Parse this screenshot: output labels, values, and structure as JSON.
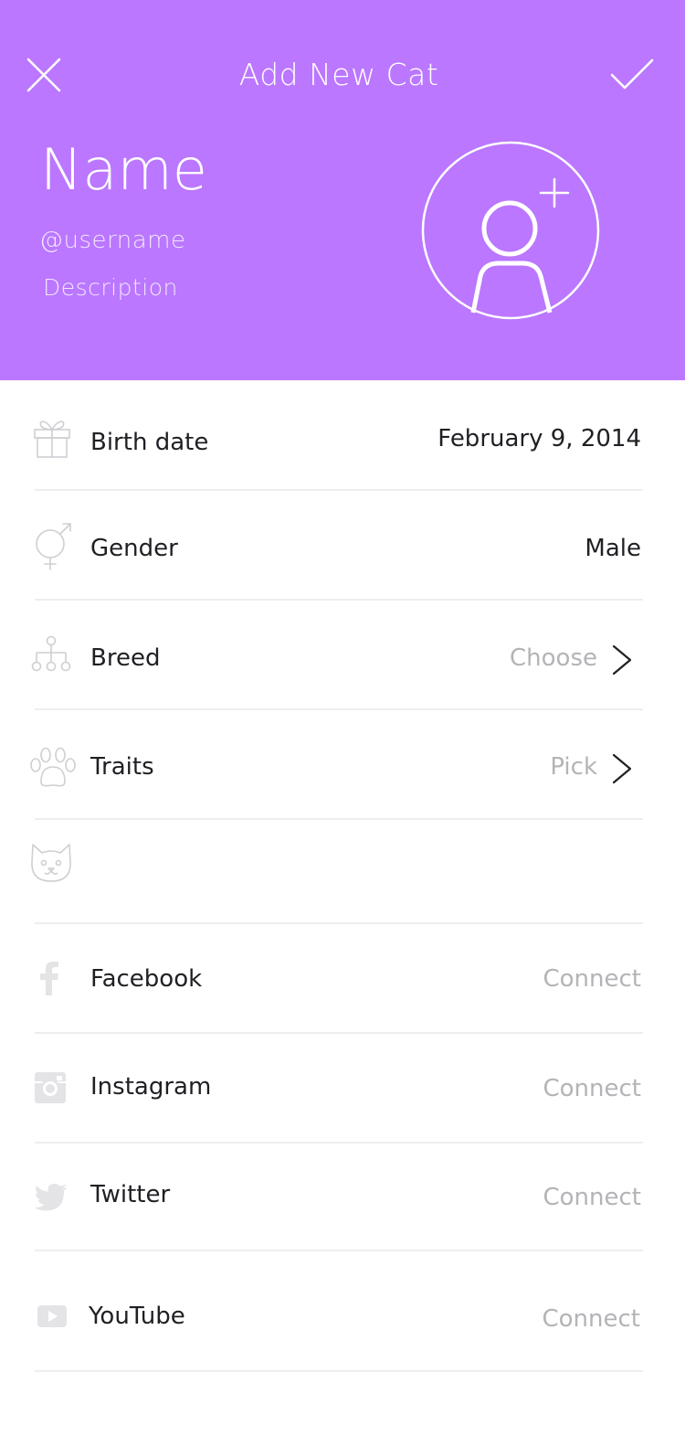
{
  "header": {
    "title": "Add New Cat",
    "name_placeholder": "Name",
    "username_placeholder": "@username",
    "description_placeholder": "Description",
    "background_color": "#bb77ff"
  },
  "rows": {
    "birth_date": {
      "label": "Birth date",
      "value": "February 9, 2014",
      "icon": "gift-icon"
    },
    "gender": {
      "label": "Gender",
      "value": "Male",
      "icon": "gender-icon"
    },
    "breed": {
      "label": "Breed",
      "value": "Choose",
      "icon": "hierarchy-icon"
    },
    "traits": {
      "label": "Traits",
      "value": "Pick",
      "icon": "paw-icon"
    },
    "cat": {
      "label": "",
      "icon": "cat-face-icon"
    },
    "facebook": {
      "label": "Facebook",
      "value": "Connect",
      "icon": "facebook-icon"
    },
    "instagram": {
      "label": "Instagram",
      "value": "Connect",
      "icon": "instagram-icon"
    },
    "twitter": {
      "label": "Twitter",
      "value": "Connect",
      "icon": "twitter-icon"
    },
    "youtube": {
      "label": "YouTube",
      "value": "Connect",
      "icon": "youtube-icon"
    }
  },
  "colors": {
    "muted_text": "#b4b4b8",
    "icon_gray": "#cfcfd3",
    "divider": "#eeeeee"
  }
}
